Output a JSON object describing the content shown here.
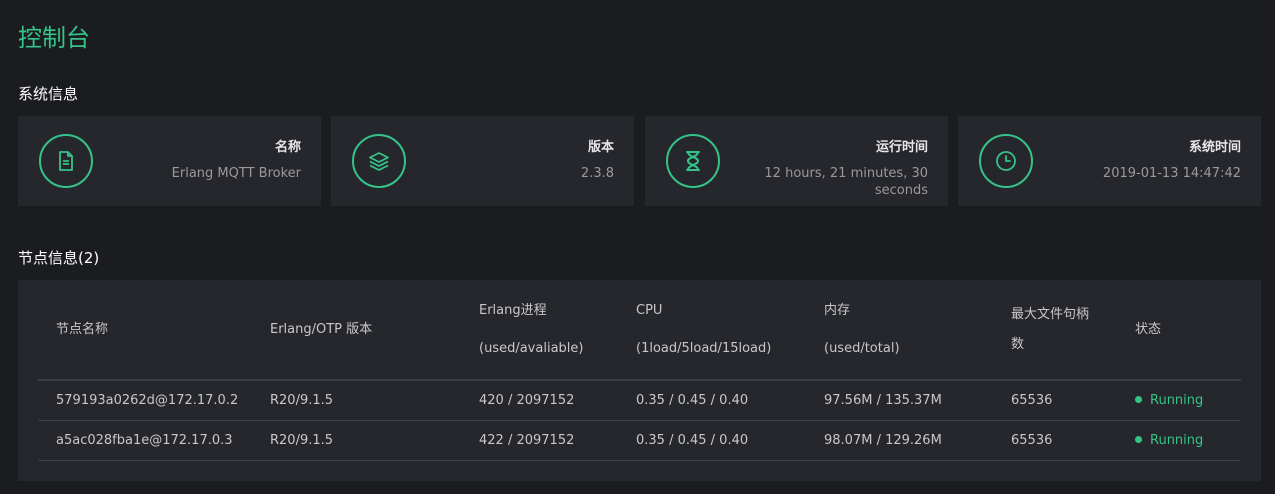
{
  "page": {
    "title": "控制台"
  },
  "system": {
    "title": "系统信息",
    "cards": [
      {
        "icon": "document-icon",
        "label": "名称",
        "value": "Erlang MQTT Broker"
      },
      {
        "icon": "layers-icon",
        "label": "版本",
        "value": "2.3.8"
      },
      {
        "icon": "hourglass-icon",
        "label": "运行时间",
        "value": "12 hours, 21 minutes, 30 seconds"
      },
      {
        "icon": "clock-icon",
        "label": "系统时间",
        "value": "2019-01-13 14:47:42"
      }
    ]
  },
  "nodes": {
    "title": "节点信息(2)",
    "columns": {
      "name": "节点名称",
      "otp": "Erlang/OTP 版本",
      "proc_a": "Erlang进程",
      "proc_b": "(used/avaliable)",
      "cpu_a": "CPU",
      "cpu_b": "(1load/5load/15load)",
      "mem_a": "内存",
      "mem_b": "(used/total)",
      "files_a": "最大文件句柄",
      "files_b": "数",
      "status": "状态"
    },
    "rows": [
      {
        "name": "579193a0262d@172.17.0.2",
        "otp": "R20/9.1.5",
        "proc": "420 / 2097152",
        "cpu": "0.35 / 0.45 / 0.40",
        "mem": "97.56M / 135.37M",
        "files": "65536",
        "status": "Running"
      },
      {
        "name": "a5ac028fba1e@172.17.0.3",
        "otp": "R20/9.1.5",
        "proc": "422 / 2097152",
        "cpu": "0.35 / 0.45 / 0.40",
        "mem": "98.07M / 129.26M",
        "files": "65536",
        "status": "Running"
      }
    ]
  },
  "colors": {
    "accent": "#34c388",
    "background": "#1b1c20",
    "card": "#26272c"
  }
}
